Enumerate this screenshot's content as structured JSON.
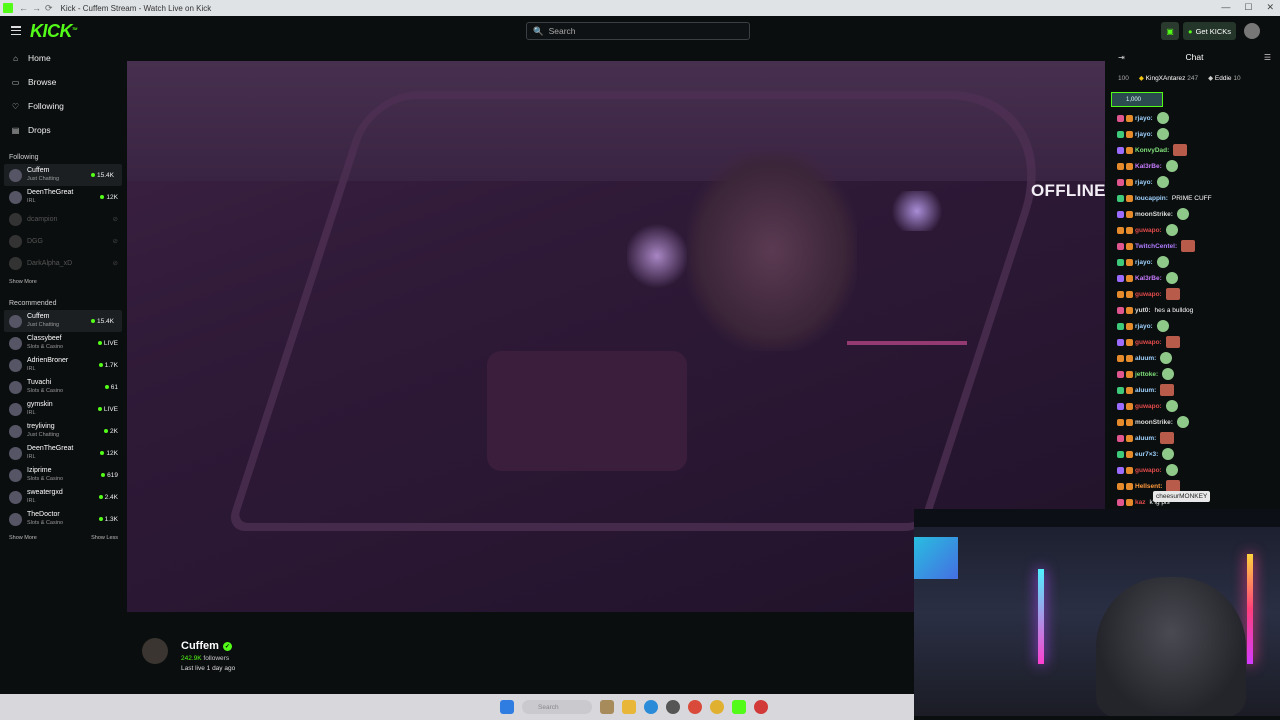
{
  "browser": {
    "tab_title": "Kick - Cuffem Stream - Watch Live on Kick"
  },
  "header": {
    "logo": "KICK",
    "search_placeholder": "Search",
    "get_kicks": "Get KICKs"
  },
  "sidebar": {
    "nav": [
      {
        "label": "Home",
        "icon": "home-icon"
      },
      {
        "label": "Browse",
        "icon": "browse-icon"
      },
      {
        "label": "Following",
        "icon": "heart-icon"
      },
      {
        "label": "Drops",
        "icon": "drops-icon"
      }
    ],
    "following_title": "Following",
    "following": [
      {
        "name": "Cuffem",
        "sub": "Just Chatting",
        "viewers": "15.4K",
        "live": true,
        "active": true
      },
      {
        "name": "DeenTheGreat",
        "sub": "IRL",
        "viewers": "12K",
        "live": true
      },
      {
        "name": "dcampion",
        "sub": "",
        "viewers": "",
        "live": false
      },
      {
        "name": "DGG",
        "sub": "",
        "viewers": "",
        "live": false
      },
      {
        "name": "DarkAlpha_xD",
        "sub": "",
        "viewers": "",
        "live": false
      }
    ],
    "show_more": "Show More",
    "recommended_title": "Recommended",
    "recommended": [
      {
        "name": "Cuffem",
        "sub": "Just Chatting",
        "viewers": "15.4K",
        "active": true
      },
      {
        "name": "Classybeef",
        "sub": "Slots & Casino",
        "viewers": "LIVE"
      },
      {
        "name": "AdrienBroner",
        "sub": "IRL",
        "viewers": "1.7K"
      },
      {
        "name": "Tuvachi",
        "sub": "Slots & Casino",
        "viewers": "61"
      },
      {
        "name": "gymskin",
        "sub": "IRL",
        "viewers": "LIVE"
      },
      {
        "name": "treyliving",
        "sub": "Just Chatting",
        "viewers": "2K"
      },
      {
        "name": "DeenTheGreat",
        "sub": "IRL",
        "viewers": "12K"
      },
      {
        "name": "Iziprime",
        "sub": "Slots & Casino",
        "viewers": "619"
      },
      {
        "name": "sweatergxd",
        "sub": "IRL",
        "viewers": "2.4K"
      },
      {
        "name": "TheDoctor",
        "sub": "Slots & Casino",
        "viewers": "1.3K"
      }
    ],
    "show_more_2": "Show More",
    "show_less": "Show Less"
  },
  "player": {
    "status": "OFFLINE"
  },
  "stream_info": {
    "name": "Cuffem",
    "followers_count": "242.9K",
    "followers_label": "followers",
    "last_live": "Last live 1 day ago"
  },
  "chat": {
    "title": "Chat",
    "leaderboard": [
      {
        "name": "100",
        "value": ""
      },
      {
        "name": "KingXAntarez",
        "value": "247"
      },
      {
        "name": "Eddie",
        "value": "10"
      }
    ],
    "pinned": "1,000",
    "messages": [
      {
        "user": "rjayo:",
        "text": "",
        "color": "#9fd3ff"
      },
      {
        "user": "rjayo:",
        "text": "",
        "color": "#9fd3ff"
      },
      {
        "user": "KonvyDad:",
        "text": "",
        "color": "#7fe07a"
      },
      {
        "user": "Kal3rBe:",
        "text": "",
        "color": "#c77dff"
      },
      {
        "user": "rjayo:",
        "text": "",
        "color": "#9fd3ff"
      },
      {
        "user": "loucappin:",
        "text": "PRIME CUFF",
        "color": "#9fd3ff"
      },
      {
        "user": "moonStrike:",
        "text": "",
        "color": "#dddddd"
      },
      {
        "user": "guwapo:",
        "text": "",
        "color": "#e04a4a"
      },
      {
        "user": "TwitchCentel:",
        "text": "",
        "color": "#b07dff"
      },
      {
        "user": "rjayo:",
        "text": "",
        "color": "#9fd3ff"
      },
      {
        "user": "Kal3rBe:",
        "text": "",
        "color": "#c77dff"
      },
      {
        "user": "guwapo:",
        "text": "",
        "color": "#e04a4a"
      },
      {
        "user": "yut0:",
        "text": "hes a bulldog",
        "color": "#dddddd"
      },
      {
        "user": "rjayo:",
        "text": "",
        "color": "#9fd3ff"
      },
      {
        "user": "guwapo:",
        "text": "",
        "color": "#e04a4a"
      },
      {
        "user": "aluum:",
        "text": "",
        "color": "#9fd3ff"
      },
      {
        "user": "jettoke:",
        "text": "",
        "color": "#7fe07a"
      },
      {
        "user": "aluum:",
        "text": "",
        "color": "#9fd3ff"
      },
      {
        "user": "guwapo:",
        "text": "",
        "color": "#e04a4a"
      },
      {
        "user": "moonStrike:",
        "text": "",
        "color": "#dddddd"
      },
      {
        "user": "aluum:",
        "text": "",
        "color": "#9fd3ff"
      },
      {
        "user": "eur7×3:",
        "text": "",
        "color": "#9fd3ff"
      },
      {
        "user": "guwapo:",
        "text": "",
        "color": "#e04a4a"
      },
      {
        "user": "Hellsent:",
        "text": "",
        "color": "#ff9a3c"
      },
      {
        "user": "kaz",
        "text": "k ig pls",
        "color": "#e04a4a"
      }
    ],
    "tooltip": "cheesurMONKEY"
  },
  "taskbar": {
    "search_placeholder": "Search"
  },
  "colors": {
    "accent": "#53fc18",
    "background": "#0b0e0f"
  }
}
